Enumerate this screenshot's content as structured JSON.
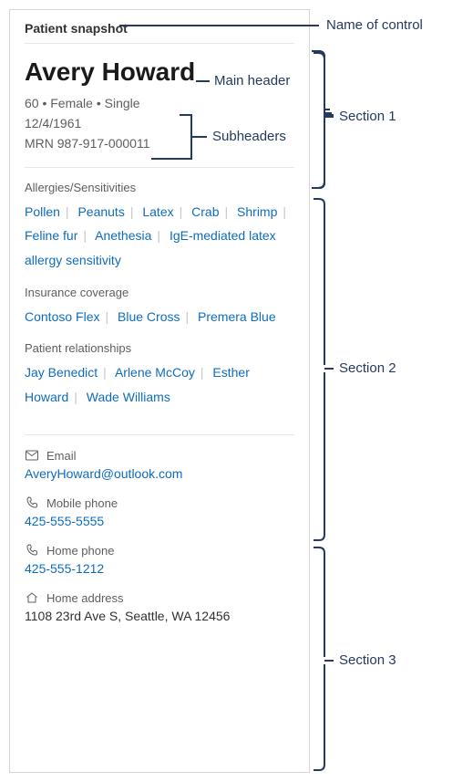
{
  "card": {
    "title": "Patient snapshot"
  },
  "header": {
    "name": "Avery Howard",
    "demographics": "60 • Female • Single",
    "dob": "12/4/1961",
    "mrn": "MRN 987-917-000011"
  },
  "groups": {
    "allergies": {
      "label": "Allergies/Sensitivities",
      "items": [
        "Pollen",
        "Peanuts",
        "Latex",
        "Crab",
        "Shrimp",
        "Feline fur",
        "Anethesia",
        "IgE-mediated latex allergy sensitivity"
      ]
    },
    "insurance": {
      "label": "Insurance coverage",
      "items": [
        "Contoso Flex",
        "Blue Cross",
        "Premera Blue"
      ]
    },
    "relationships": {
      "label": "Patient relationships",
      "items": [
        "Jay Benedict",
        "Arlene McCoy",
        "Esther Howard",
        "Wade Williams"
      ]
    }
  },
  "contacts": {
    "email": {
      "label": "Email",
      "value": "AveryHoward@outlook.com"
    },
    "mobile": {
      "label": "Mobile phone",
      "value": "425-555-5555"
    },
    "home_phone": {
      "label": "Home phone",
      "value": "425-555-1212"
    },
    "home_address": {
      "label": "Home address",
      "value": "1108 23rd Ave S, Seattle, WA 12456"
    }
  },
  "annotations": {
    "name_of_control": "Name of control",
    "main_header": "Main header",
    "subheaders": "Subheaders",
    "section1": "Section 1",
    "section2": "Section 2",
    "section3": "Section 3"
  }
}
